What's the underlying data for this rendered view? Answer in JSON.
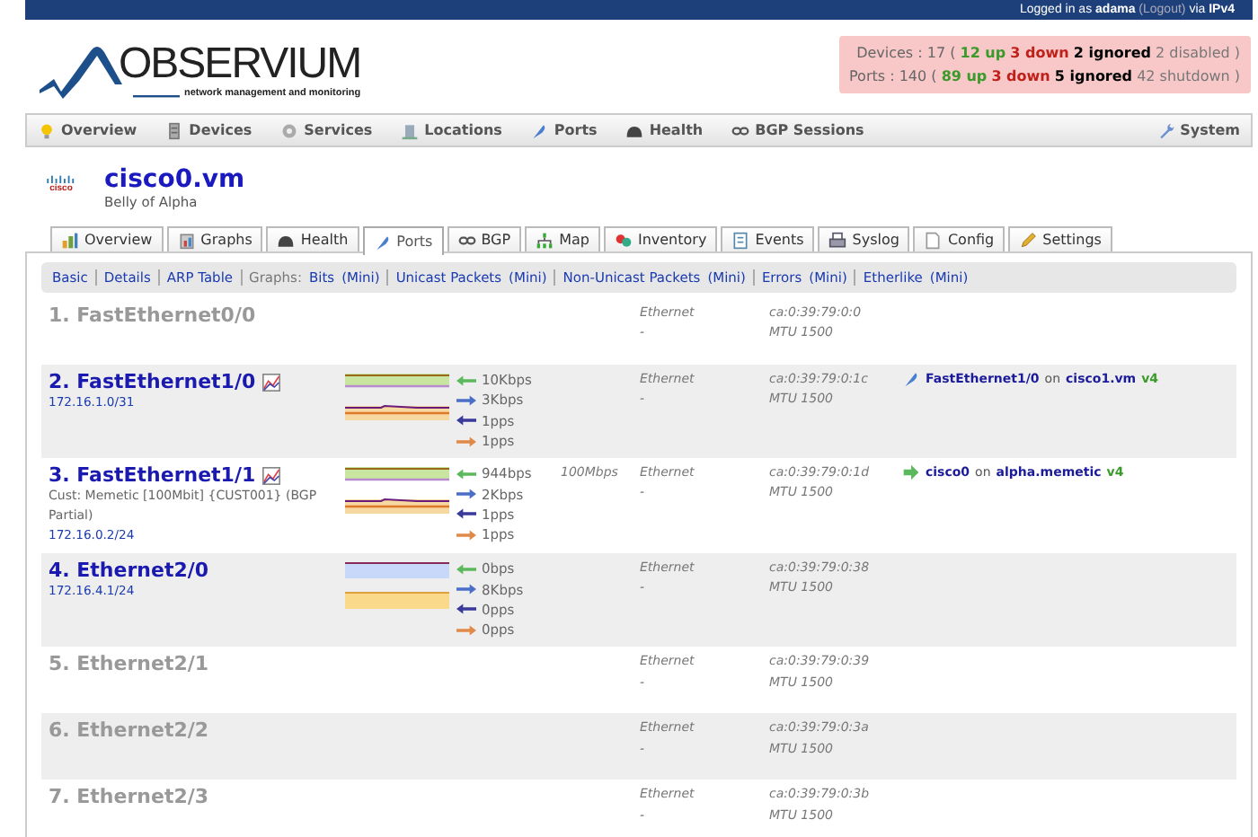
{
  "login": {
    "before": "Logged in as",
    "user": "adama",
    "logout": "(Logout)",
    "via": "via",
    "protocol": "IPv4"
  },
  "logo": {
    "name": "OBSERVIUM",
    "tagline": "network management and monitoring"
  },
  "summary": [
    {
      "label": "Devices :",
      "total": "17",
      "parts": [
        {
          "kind": "plain",
          "text": "("
        },
        {
          "kind": "up",
          "text": "12 up"
        },
        {
          "kind": "down",
          "text": "3 down"
        },
        {
          "kind": "ignored",
          "text": "2 ignored"
        },
        {
          "kind": "muted",
          "text": "2 disabled )"
        }
      ]
    },
    {
      "label": "Ports :",
      "total": "140",
      "parts": [
        {
          "kind": "plain",
          "text": "("
        },
        {
          "kind": "up",
          "text": "89 up"
        },
        {
          "kind": "down",
          "text": "3 down"
        },
        {
          "kind": "ignored",
          "text": "5 ignored"
        },
        {
          "kind": "muted",
          "text": "42 shutdown )"
        }
      ]
    }
  ],
  "nav": {
    "items": [
      "Overview",
      "Devices",
      "Services",
      "Locations",
      "Ports",
      "Health",
      "BGP Sessions"
    ],
    "system": "System"
  },
  "device": {
    "logo_text": "cisco",
    "hostname": "cisco0.vm",
    "location": "Belly of Alpha"
  },
  "tabs": [
    {
      "label": "Overview",
      "selected": false
    },
    {
      "label": "Graphs",
      "selected": false
    },
    {
      "label": "Health",
      "selected": false
    },
    {
      "label": "Ports",
      "selected": true
    },
    {
      "label": "BGP",
      "selected": false
    },
    {
      "label": "Map",
      "selected": false
    },
    {
      "label": "Inventory",
      "selected": false
    },
    {
      "label": "Events",
      "selected": false
    },
    {
      "label": "Syslog",
      "selected": false
    },
    {
      "label": "Config",
      "selected": false
    },
    {
      "label": "Settings",
      "selected": false
    }
  ],
  "subnav": [
    {
      "kind": "link",
      "text": "Basic"
    },
    {
      "kind": "link",
      "text": "Details"
    },
    {
      "kind": "link",
      "text": "ARP Table"
    },
    {
      "kind": "label",
      "text": "Graphs:"
    },
    {
      "kind": "link",
      "text": "Bits",
      "mini": "(Mini)"
    },
    {
      "kind": "link",
      "text": "Unicast Packets",
      "mini": "(Mini)"
    },
    {
      "kind": "link",
      "text": "Non-Unicast Packets",
      "mini": "(Mini)"
    },
    {
      "kind": "link",
      "text": "Errors",
      "mini": "(Mini)"
    },
    {
      "kind": "link",
      "text": "Etherlike",
      "mini": "(Mini)"
    }
  ],
  "ports": [
    {
      "name": "1. FastEthernet0/0",
      "up": false,
      "graph_link": false,
      "type": "Ethernet",
      "dash": "-",
      "mac": "ca:0:39:79:0:0",
      "mtu": "MTU 1500"
    },
    {
      "name": "2. FastEthernet1/0",
      "up": true,
      "graph_link": true,
      "addresses": [
        "172.16.1.0/31"
      ],
      "graph": {
        "kind": "busy"
      },
      "traffic": [
        {
          "kind": "in-bits",
          "text": "10Kbps"
        },
        {
          "kind": "out-bits",
          "text": "3Kbps"
        },
        {
          "kind": "in-pps",
          "text": "1pps"
        },
        {
          "kind": "out-pps",
          "text": "1pps"
        }
      ],
      "type": "Ethernet",
      "dash": "-",
      "mac": "ca:0:39:79:0:1c",
      "mtu": "MTU 1500",
      "neighbor": {
        "kind": "port",
        "port": "FastEthernet1/0",
        "joiner": "on",
        "host": "cisco1.vm",
        "proto": "v4"
      }
    },
    {
      "name": "3. FastEthernet1/1",
      "up": true,
      "graph_link": true,
      "description": "Cust: Memetic [100Mbit] {CUST001} (BGP Partial)",
      "addresses": [
        "172.16.0.2/24"
      ],
      "graph": {
        "kind": "busy"
      },
      "traffic": [
        {
          "kind": "in-bits",
          "text": "944bps"
        },
        {
          "kind": "out-bits",
          "text": "2Kbps"
        },
        {
          "kind": "in-pps",
          "text": "1pps"
        },
        {
          "kind": "out-pps",
          "text": "1pps"
        }
      ],
      "speed": "100Mbps",
      "type": "Ethernet",
      "dash": "-",
      "mac": "ca:0:39:79:0:1d",
      "mtu": "MTU 1500",
      "neighbor": {
        "kind": "arrow",
        "port": "cisco0",
        "joiner": "on",
        "host": "alpha.memetic",
        "proto": "v4"
      }
    },
    {
      "name": "4. Ethernet2/0",
      "up": true,
      "graph_link": false,
      "addresses": [
        "172.16.4.1/24"
      ],
      "graph": {
        "kind": "flat"
      },
      "traffic": [
        {
          "kind": "in-bits",
          "text": "0bps"
        },
        {
          "kind": "out-bits",
          "text": "8Kbps"
        },
        {
          "kind": "in-pps",
          "text": "0pps"
        },
        {
          "kind": "out-pps",
          "text": "0pps"
        }
      ],
      "type": "Ethernet",
      "dash": "-",
      "mac": "ca:0:39:79:0:38",
      "mtu": "MTU 1500"
    },
    {
      "name": "5. Ethernet2/1",
      "up": false,
      "graph_link": false,
      "type": "Ethernet",
      "dash": "-",
      "mac": "ca:0:39:79:0:39",
      "mtu": "MTU 1500"
    },
    {
      "name": "6. Ethernet2/2",
      "up": false,
      "graph_link": false,
      "type": "Ethernet",
      "dash": "-",
      "mac": "ca:0:39:79:0:3a",
      "mtu": "MTU 1500"
    },
    {
      "name": "7. Ethernet2/3",
      "up": false,
      "graph_link": false,
      "type": "Ethernet",
      "dash": "-",
      "mac": "ca:0:39:79:0:3b",
      "mtu": "MTU 1500"
    }
  ]
}
